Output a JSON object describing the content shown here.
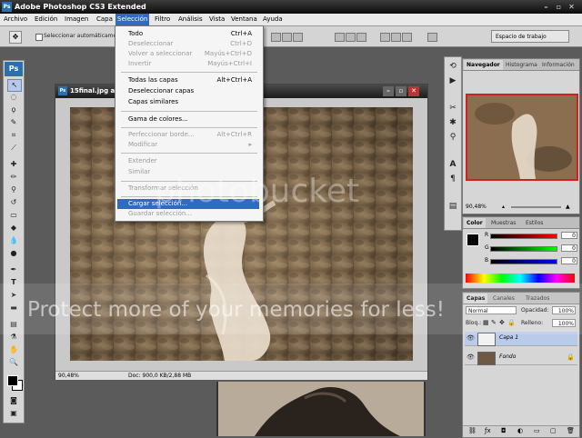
{
  "window": {
    "app_icon": "Ps",
    "title": "Adobe Photoshop CS3 Extended"
  },
  "menubar": {
    "items": [
      "Archivo",
      "Edición",
      "Imagen",
      "Capa",
      "Selección",
      "Filtro",
      "Análisis",
      "Vista",
      "Ventana",
      "Ayuda"
    ],
    "active_item": "Selección"
  },
  "options_bar": {
    "auto_select_label": "Seleccionar automáticamente",
    "workspace_label": "Espacio de trabajo"
  },
  "toolbox": {
    "logo": "Ps"
  },
  "selection_menu": {
    "items": [
      {
        "label": "Todo",
        "shortcut": "Ctrl+A",
        "enabled": true
      },
      {
        "label": "Deseleccionar",
        "shortcut": "Ctrl+D",
        "enabled": false
      },
      {
        "label": "Volver a seleccionar",
        "shortcut": "Mayús+Ctrl+D",
        "enabled": false
      },
      {
        "label": "Invertir",
        "shortcut": "Mayús+Ctrl+I",
        "enabled": false
      },
      {
        "label": "Todas las capas",
        "shortcut": "Alt+Ctrl+A",
        "enabled": true
      },
      {
        "label": "Deseleccionar capas",
        "shortcut": "",
        "enabled": true
      },
      {
        "label": "Capas similares",
        "shortcut": "",
        "enabled": true
      },
      {
        "label": "Gama de colores...",
        "shortcut": "",
        "enabled": true
      },
      {
        "label": "Perfeccionar borde...",
        "shortcut": "Alt+Ctrl+R",
        "enabled": false
      },
      {
        "label": "Modificar",
        "shortcut": "",
        "enabled": false
      },
      {
        "label": "Extender",
        "shortcut": "",
        "enabled": false
      },
      {
        "label": "Similar",
        "shortcut": "",
        "enabled": false
      },
      {
        "label": "Transformar selección",
        "shortcut": "",
        "enabled": false
      },
      {
        "label": "Cargar selección...",
        "shortcut": "",
        "enabled": true,
        "highlighted": true
      },
      {
        "label": "Guardar selección...",
        "shortcut": "",
        "enabled": false
      }
    ]
  },
  "document": {
    "title": "15final.jpg al 90",
    "zoom": "90,48%",
    "status": "Doc: 900,0 KB/2,88 MB"
  },
  "navigator": {
    "tabs": [
      "Navegador",
      "Histograma",
      "Información"
    ],
    "zoom": "90,48%"
  },
  "color_panel": {
    "tabs": [
      "Color",
      "Muestras",
      "Estilos"
    ],
    "channels": [
      {
        "label": "R",
        "value": "0"
      },
      {
        "label": "G",
        "value": "0"
      },
      {
        "label": "B",
        "value": "0"
      }
    ]
  },
  "layers_panel": {
    "tabs": [
      "Capas",
      "Canales",
      "Trazados"
    ],
    "blend_mode": "Normal",
    "opacity_label": "Opacidad:",
    "opacity_value": "100%",
    "lock_label": "Bloq.:",
    "fill_label": "Relleno:",
    "fill_value": "100%",
    "layers": [
      {
        "name": "Capa 1",
        "selected": true
      },
      {
        "name": "Fondo",
        "selected": false
      }
    ]
  },
  "watermark": {
    "logo_text": "photobucket",
    "banner_text": "Protect more of your memories for less!"
  },
  "colors": {
    "menu_highlight": "#316ac5",
    "navigator_frame": "#d02020",
    "ps_blue": "#2a6fb0"
  }
}
